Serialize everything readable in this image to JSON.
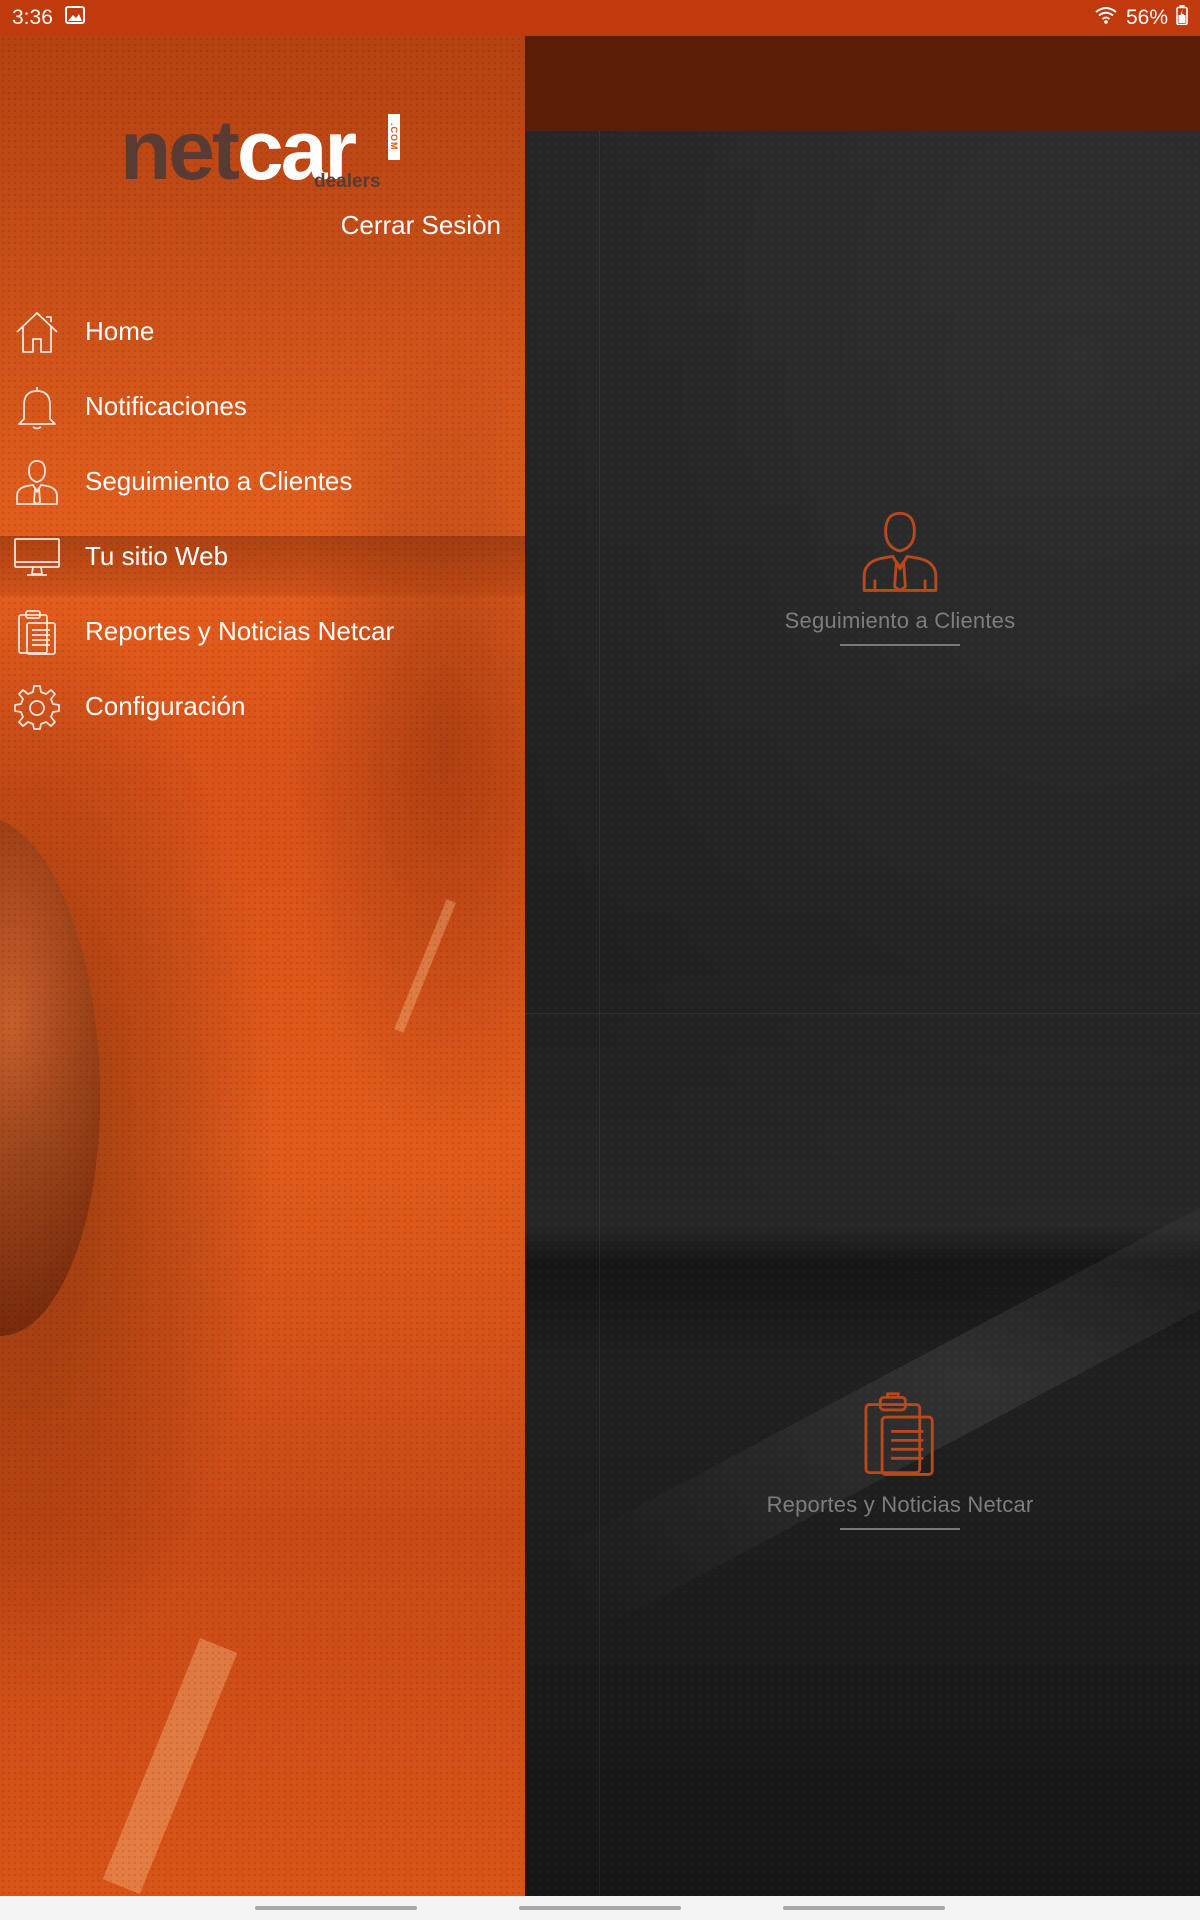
{
  "status_bar": {
    "time": "3:36",
    "battery": "56%",
    "icons": [
      "image-icon",
      "wifi-icon",
      "battery-icon"
    ]
  },
  "drawer": {
    "logo": {
      "net": "net",
      "car": "car",
      "com": ".COM",
      "dealers": "dealers"
    },
    "logout_label": "Cerrar Sesiòn",
    "items": [
      {
        "label": "Home",
        "icon": "home-icon"
      },
      {
        "label": "Notificaciones",
        "icon": "bell-icon"
      },
      {
        "label": "Seguimiento a Clientes",
        "icon": "user-icon"
      },
      {
        "label": "Tu sitio Web",
        "icon": "monitor-icon"
      },
      {
        "label": "Reportes y Noticias Netcar",
        "icon": "clipboard-icon"
      },
      {
        "label": "Configuración",
        "icon": "gear-icon"
      }
    ]
  },
  "main": {
    "tiles": [
      {
        "label": "Seguimiento a Clientes",
        "icon": "user-icon"
      },
      {
        "label": "Reportes y Noticias Netcar",
        "icon": "clipboard-icon"
      }
    ]
  },
  "colors": {
    "accent": "#e0591c",
    "status_bar": "#c13a0e",
    "header_dark": "#5c1d07",
    "tile_icon": "#b8481d"
  }
}
